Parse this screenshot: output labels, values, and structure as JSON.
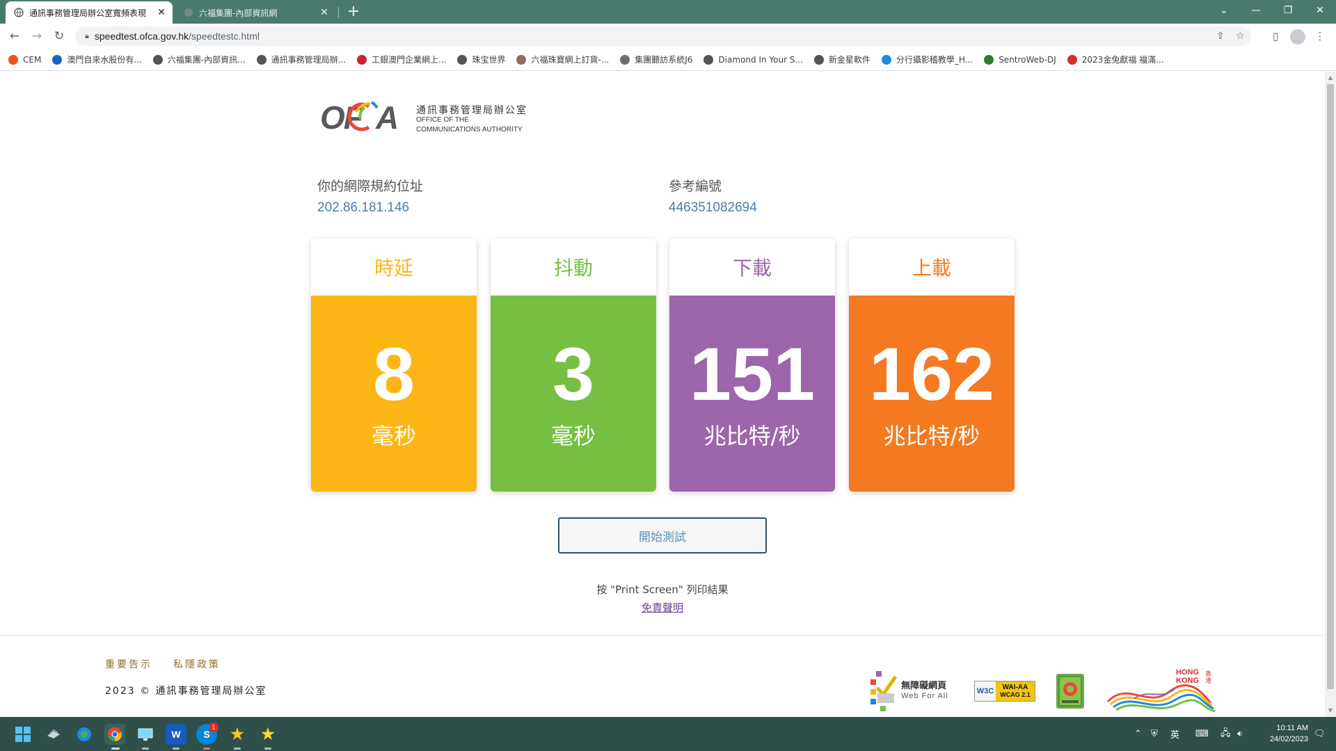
{
  "browser": {
    "tabs": [
      {
        "title": "通訊事務管理局辦公室寬頻表現"
      },
      {
        "title": "六福集團-內部資訊網"
      }
    ],
    "new_tab": "+",
    "url_host": "speedtest.ofca.gov.hk",
    "url_path": "/speedtestc.html",
    "bookmarks": [
      {
        "label": "CEM",
        "color": "#e8541a"
      },
      {
        "label": "澳門自來水股份有...",
        "color": "#1565c0"
      },
      {
        "label": "六福集團-內部資訊...",
        "color": "#555555"
      },
      {
        "label": "通訊事務管理局辦...",
        "color": "#555555"
      },
      {
        "label": "工銀澳門企業網上...",
        "color": "#c62828"
      },
      {
        "label": "珠宝世界",
        "color": "#555555"
      },
      {
        "label": "六福珠寶網上訂貨-...",
        "color": "#8d6e63"
      },
      {
        "label": "集團聽訪系統J6",
        "color": "#6d6d6d"
      },
      {
        "label": "Diamond In Your S...",
        "color": "#555555"
      },
      {
        "label": "新金星軟件",
        "color": "#555555"
      },
      {
        "label": "分行攝影稽教學_H...",
        "color": "#1e88e5"
      },
      {
        "label": "SentroWeb-DJ",
        "color": "#2e7d32"
      },
      {
        "label": "2023金兔獻福 福滿...",
        "color": "#d32f2f"
      }
    ]
  },
  "logo": {
    "mark": "OFCA",
    "zh": "通訊事務管理局辦公室",
    "en_line1": "OFFICE OF THE",
    "en_line2": "COMMUNICATIONS AUTHORITY"
  },
  "info": {
    "ip_label": "你的網際規約位址",
    "ip_value": "202.86.181.146",
    "ref_label": "參考編號",
    "ref_value": "446351082694"
  },
  "results": [
    {
      "title": "時延",
      "value": "8",
      "unit": "毫秒",
      "color": "#fbb616"
    },
    {
      "title": "抖動",
      "value": "3",
      "unit": "毫秒",
      "color": "#76bf43"
    },
    {
      "title": "下載",
      "value": "151",
      "unit": "兆比特/秒",
      "color": "#9d65aa"
    },
    {
      "title": "上載",
      "value": "162",
      "unit": "兆比特/秒",
      "color": "#f47920"
    }
  ],
  "start_button": "開始測試",
  "hint": "按 \"Print Screen\" 列印結果",
  "disclaimer": "免責聲明",
  "footer": {
    "link_notice": "重要告示",
    "link_privacy": "私隱政策",
    "copyright": "2023 © 通訊事務管理局辦公室",
    "badge_wfa_zh": "無障礙網頁",
    "badge_wfa_en": "Web For All",
    "badge_w3c": "W3C",
    "badge_wcag1": "WAI-AA",
    "badge_wcag2": "WCAG 2.1",
    "badge_hk1": "HONG",
    "badge_hk2": "KONG",
    "badge_hk_zh": "香港"
  },
  "taskbar": {
    "ime": "英",
    "clock_time": "10:11 AM",
    "clock_date": "24/02/2023",
    "skype_badge": "1"
  }
}
